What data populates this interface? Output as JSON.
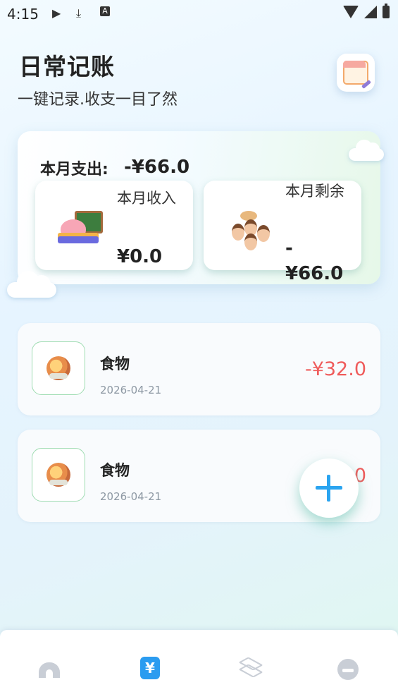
{
  "status_bar": {
    "time": "4:15",
    "icons": [
      "play-store-icon",
      "download-icon",
      "text-a-icon",
      "wifi-icon",
      "cellular-icon",
      "battery-icon"
    ]
  },
  "header": {
    "title": "日常记账",
    "subtitle": "一键记录.收支一目了然",
    "calendar_icon": "calendar-icon"
  },
  "summary": {
    "expense_label": "本月支出:",
    "expense_value": "-¥66.0",
    "income": {
      "label": "本月收入",
      "value": "¥0.0"
    },
    "remaining": {
      "label": "本月剩余",
      "value": "-¥66.0"
    }
  },
  "transactions": [
    {
      "category": "食物",
      "date": "2026-04-21",
      "amount": "-¥32.0",
      "icon": "food-icon"
    },
    {
      "category": "食物",
      "date": "2026-04-21",
      "amount": "0",
      "icon": "food-icon"
    }
  ],
  "fab": {
    "icon": "plus-icon"
  },
  "bottom_nav": [
    {
      "icon": "home-icon"
    },
    {
      "icon": "bill-icon",
      "glyph": "¥"
    },
    {
      "icon": "layers-icon"
    },
    {
      "icon": "profile-icon"
    }
  ],
  "colors": {
    "accent": "#2aa4f0",
    "expense_red": "#ef5b5b",
    "inactive_nav": "#c9ced6"
  }
}
